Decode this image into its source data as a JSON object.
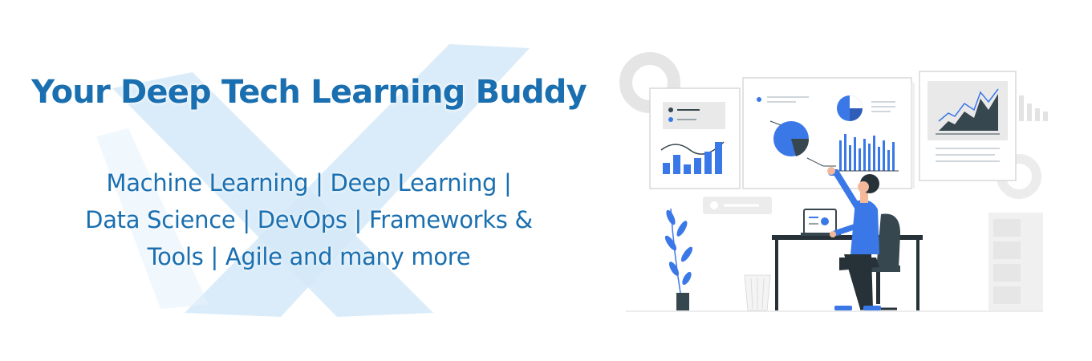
{
  "banner": {
    "headline": "Your Deep Tech Learning Buddy",
    "tagline_lines": [
      "Machine Learning | Deep Learning |",
      "Data Science | DevOps | Frameworks &",
      "Tools | Agile and many more"
    ]
  },
  "colors": {
    "text_blue": "#1a6fb0",
    "accent_blue": "#3b78e7",
    "watermark_blue": "#cfe6f6",
    "dark": "#37474f",
    "grey": "#e3e3e3"
  },
  "icons": {
    "watermark": "x-logo-icon",
    "illustration": "data-analyst-illustration"
  }
}
